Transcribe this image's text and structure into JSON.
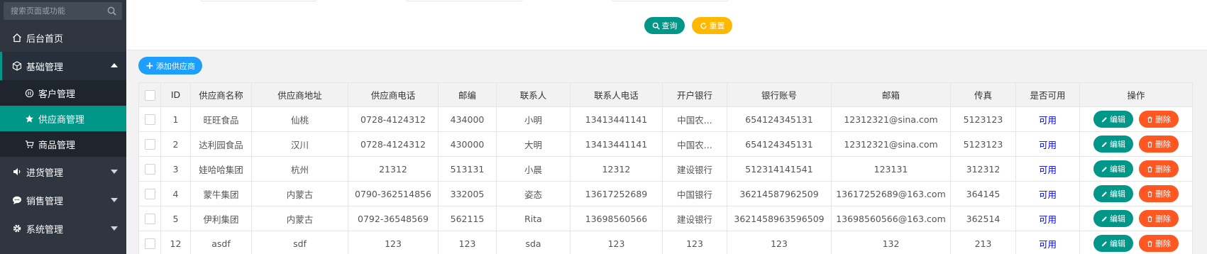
{
  "sidebar": {
    "search_placeholder": "搜索页面或功能",
    "home": "后台首页",
    "groups": [
      {
        "label": "基础管理",
        "children": [
          "客户管理",
          "供应商管理",
          "商品管理"
        ]
      },
      {
        "label": "进货管理"
      },
      {
        "label": "销售管理"
      },
      {
        "label": "系统管理"
      }
    ]
  },
  "filters": {
    "query_label": "查询",
    "reset_label": "重置"
  },
  "toolbar": {
    "add_label": "添加供应商"
  },
  "table": {
    "headers": [
      "ID",
      "供应商名称",
      "供应商地址",
      "供应商电话",
      "邮编",
      "联系人",
      "联系人电话",
      "开户银行",
      "银行账号",
      "邮箱",
      "传真",
      "是否可用",
      "操作"
    ],
    "edit_label": "编辑",
    "delete_label": "删除",
    "rows": [
      [
        "1",
        "旺旺食品",
        "仙桃",
        "0728-4124312",
        "434000",
        "小明",
        "13413441141",
        "中国农...",
        "654124345131",
        "12312321@sina.com",
        "5123123",
        "可用"
      ],
      [
        "2",
        "达利园食品",
        "汉川",
        "0728-4124312",
        "430000",
        "大明",
        "13413441141",
        "中国农...",
        "654124345131",
        "12312321@sina.com",
        "5123123",
        "可用"
      ],
      [
        "3",
        "娃哈哈集团",
        "杭州",
        "21312",
        "513131",
        "小晨",
        "12312",
        "建设银行",
        "512314141541",
        "123131",
        "312312",
        "可用"
      ],
      [
        "4",
        "蒙牛集团",
        "内蒙古",
        "0790-362514856",
        "332005",
        "姿态",
        "13617252689",
        "中国银行",
        "36214587962509",
        "13617252689@163.com",
        "364145",
        "可用"
      ],
      [
        "5",
        "伊利集团",
        "内蒙古",
        "0792-36548569",
        "562115",
        "Rita",
        "13698560566",
        "建设银行",
        "3621458963596509",
        "13698560566@163.com",
        "362514",
        "可用"
      ],
      [
        "12",
        "asdf",
        "sdf",
        "123",
        "123",
        "sda",
        "123",
        "123",
        "123",
        "132",
        "213",
        "可用"
      ]
    ]
  }
}
